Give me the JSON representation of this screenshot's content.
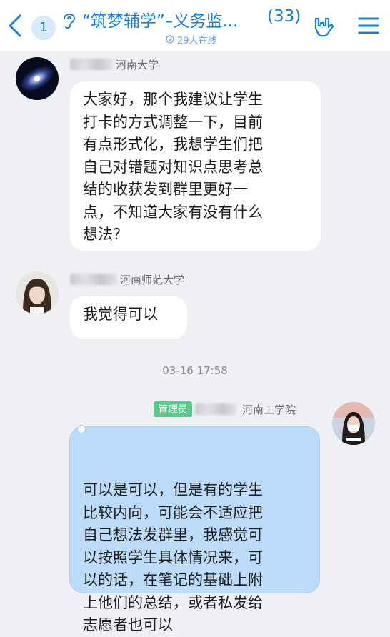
{
  "header": {
    "unread": "1",
    "title": "“筑梦辅学”–义务监...",
    "member_count": "(33)",
    "online": "29人在线"
  },
  "messages": [
    {
      "school": "河南大学",
      "text": "大家好，那个我建议让学生\n打卡的方式调整一下，目前\n有点形式化，我想学生们把\n自己对错题对知识点思考总\n结的收获发到群里更好一\n点，不知道大家有没有什么\n想法？"
    },
    {
      "school": "河南师范大学",
      "text": "我觉得可以"
    },
    {
      "role": "管理员",
      "school": "河南工学院",
      "text": "可以是可以，但是有的学生\n比较内向，可能会不适应把\n自己想法发群里，我感觉可\n以按照学生具体情况来，可\n以的话，在笔记的基础上附\n上他们的总结，或者私发给\n志愿者也可以"
    }
  ],
  "timestamp": "03-16 17:58",
  "colors": {
    "accent": "#1a7fd6",
    "self_bubble": "#bcdbf8",
    "admin_badge": "#5bc98a"
  }
}
